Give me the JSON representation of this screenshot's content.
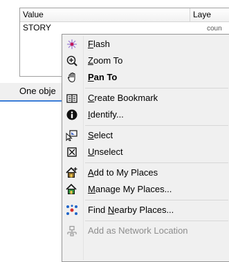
{
  "table": {
    "col_value": "Value",
    "col_layer": "Laye",
    "row1_value": "STORY",
    "row1_layer": "coun"
  },
  "status": {
    "text": "One obje"
  },
  "menu": {
    "items": [
      {
        "label_pre": "",
        "label_u": "F",
        "label_post": "lash",
        "icon": "flash-icon"
      },
      {
        "label_pre": "",
        "label_u": "Z",
        "label_post": "oom To",
        "icon": "zoom-to-icon"
      },
      {
        "label_pre": "",
        "label_u": "P",
        "label_post": "an To",
        "icon": "pan-hand-icon"
      },
      {
        "label_pre": "",
        "label_u": "C",
        "label_post": "reate Bookmark",
        "icon": "bookmark-icon"
      },
      {
        "label_pre": "",
        "label_u": "I",
        "label_post": "dentify...",
        "icon": "identify-icon"
      },
      {
        "label_pre": "",
        "label_u": "S",
        "label_post": "elect",
        "icon": "select-icon"
      },
      {
        "label_pre": "",
        "label_u": "U",
        "label_post": "nselect",
        "icon": "unselect-icon"
      },
      {
        "label_pre": "",
        "label_u": "A",
        "label_post": "dd to My Places",
        "icon": "add-place-icon"
      },
      {
        "label_pre": "",
        "label_u": "M",
        "label_post": "anage My Places...",
        "icon": "manage-places-icon"
      },
      {
        "label_pre": "Find ",
        "label_u": "N",
        "label_post": "earby Places...",
        "icon": "nearby-places-icon"
      },
      {
        "label_pre": "",
        "label_u": "",
        "label_post": "Add as Network Location",
        "icon": "network-location-icon"
      }
    ]
  }
}
